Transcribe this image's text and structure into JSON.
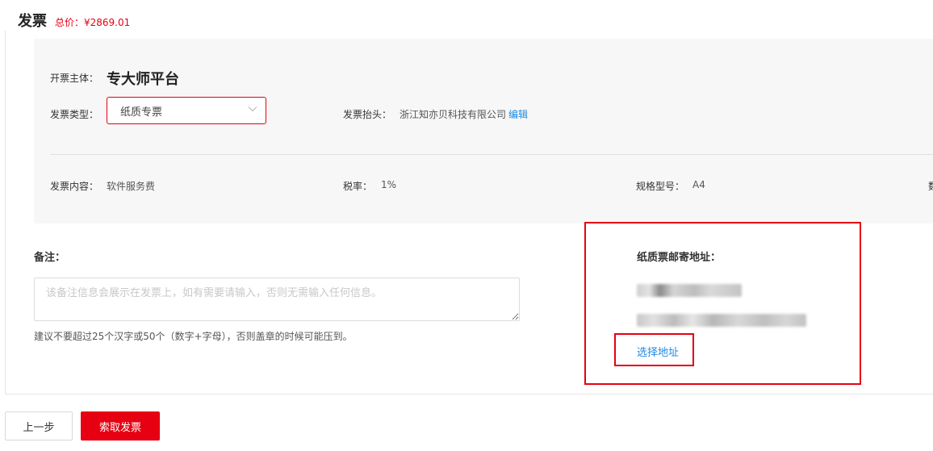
{
  "header": {
    "title": "发票",
    "total_price": "总价：¥2869.01"
  },
  "invoice": {
    "entity_label": "开票主体：",
    "entity_value": "专大师平台",
    "type_label": "发票类型：",
    "type_value": "纸质专票",
    "title_label": "发票抬头：",
    "title_value": "浙江知亦贝科技有限公司",
    "edit_link": "编辑",
    "content_label": "发票内容：",
    "content_value": "软件服务费",
    "tax_label": "税率：",
    "tax_value": "1%",
    "spec_label": "规格型号：",
    "spec_value": "A4",
    "partial_col": "数"
  },
  "remark": {
    "label": "备注：",
    "placeholder": "该备注信息会展示在发票上，如有需要请输入，否则无需输入任何信息。",
    "hint": "建议不要超过25个汉字或50个（数字+字母），否则盖章的时候可能压到。"
  },
  "address": {
    "title": "纸质票邮寄地址：",
    "select_link": "选择地址"
  },
  "footer": {
    "prev_label": "上一步",
    "submit_label": "索取发票"
  },
  "colors": {
    "accent": "#e60012",
    "link": "#1e88e5",
    "panel_bg": "#f7f7f7"
  },
  "icons": {
    "select_chevron": "chevron-down-icon"
  }
}
